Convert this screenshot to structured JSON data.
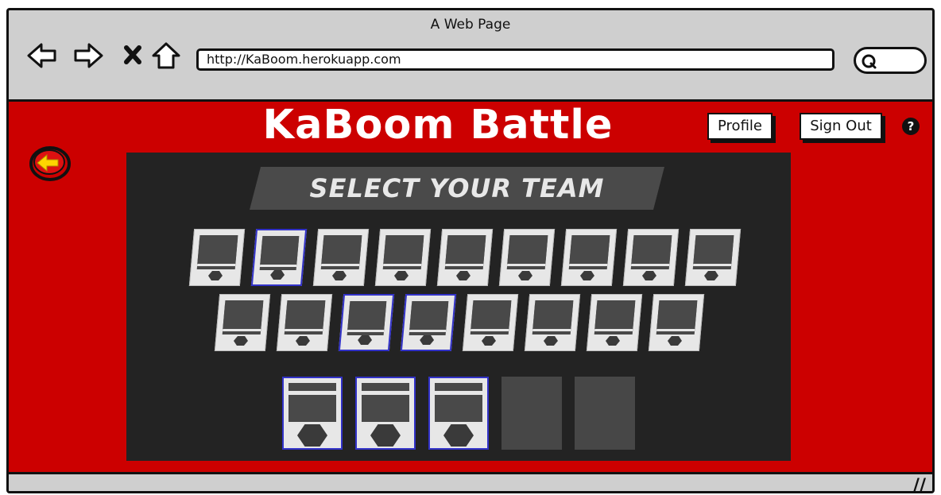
{
  "browser": {
    "window_title": "A Web Page",
    "url": "http://KaBoom.herokuapp.com",
    "nav_icons": [
      "back-arrow-icon",
      "forward-arrow-icon",
      "stop-icon",
      "home-icon"
    ],
    "search_icon": "search-icon"
  },
  "app": {
    "title": "KaBoom Battle",
    "profile_label": "Profile",
    "signout_label": "Sign Out",
    "help_label": "?",
    "back_icon": "back-arrow-icon",
    "colors": {
      "background": "#cc0000",
      "panel": "#232323",
      "selected_border": "#3232c8"
    }
  },
  "selection": {
    "banner": "SELECT YOUR TEAM",
    "roster_row1_selected": [
      false,
      true,
      false,
      false,
      false,
      false,
      false,
      false,
      false
    ],
    "roster_row2_selected": [
      false,
      false,
      true,
      true,
      false,
      false,
      false,
      false
    ],
    "team_slots": [
      "filled",
      "filled",
      "filled",
      "empty",
      "empty"
    ]
  }
}
